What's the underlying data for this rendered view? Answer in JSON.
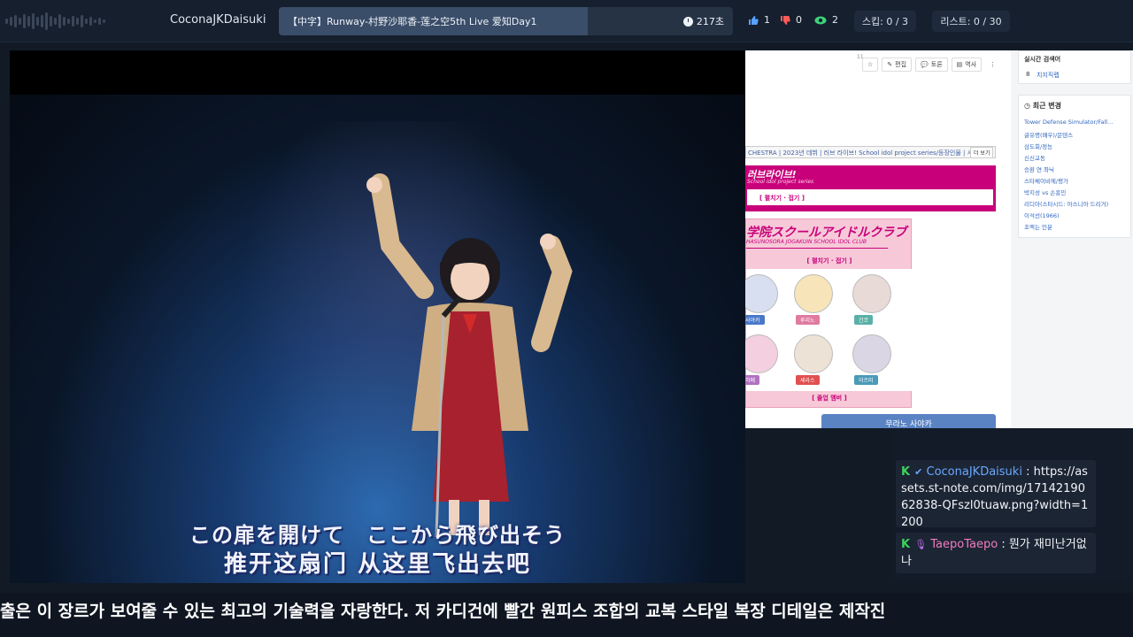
{
  "topbar": {
    "streamer": "CoconaJKDaisuki",
    "now_playing_title": "【中字】Runway-村野沙耶香-莲之空5th Live 爱知Day1",
    "now_playing_time": "217초",
    "now_playing_progress": 0.68,
    "likes": "1",
    "dislikes": "0",
    "views": "2",
    "skip": "스킵: 0 / 3",
    "list": "리스트: 0 / 30"
  },
  "video": {
    "subtitle_jp": "この扉を開けて　ここから飛び出そう",
    "subtitle_cn": "推开这扇门 从这里飞出去吧"
  },
  "wiki": {
    "tools": [
      "편집",
      "토론",
      "역사"
    ],
    "breadcrumb": "CHESTRA | 2023년 데뷔 | 러브 라이브! School idol project series/등장인물 | 시",
    "breadcrumb_more": "더 보기",
    "banner_logo": "러브라이브!",
    "banner_sub": "School idol project series",
    "banner_fold": "[ 펼치기 · 접기 ]",
    "club_logo": "学院スクールアイドルクラブ",
    "club_sub": "HASUNOSORA JOGAKUIN SCHOOL IDOL CLUB",
    "club_fold": "[ 펼치기 · 접기 ]",
    "members": [
      {
        "name": "사야카",
        "color": "#4a78c8"
      },
      {
        "name": "루리노",
        "color": "#e07aa0"
      },
      {
        "name": "긴코",
        "color": "#5ab0a8"
      },
      {
        "name": "히메",
        "color": "#b070c0"
      },
      {
        "name": "세라스",
        "color": "#e05050"
      },
      {
        "name": "이즈미",
        "color": "#4a9ab8"
      }
    ],
    "club_bottom": "[ 졸업 멤버 ]",
    "button": "무라노 사야카",
    "side_realtime_title": "실시간 검색어",
    "side_realtime_item": "치지직렙",
    "side_realtime_rank": "8",
    "page_number": "11",
    "side_recent_title": "최근 변경",
    "recent": [
      "Tower Defense Simulator/Fall...",
      "글유명(배우)/문텐스",
      "삼도회/정능",
      "신신교동",
      "승환 연 좌닉",
      "스타체이비에/평가",
      "박지성 vs 손흥민",
      "리디아(스타시드: 아스니아 드리거)",
      "이석선(1966)",
      "초맥는 인분"
    ]
  },
  "chat": [
    {
      "user": "CoconaJKDaisuki",
      "text": "https://assets.st-note.com/img/1714219062838-QFszl0tuaw.png?width=1200",
      "color": "#6aa8ff"
    },
    {
      "user": "TaepoTaepo",
      "text": "뭔가 재미난거없나",
      "color": "#f07cc0"
    }
  ],
  "caption": "출은 이 장르가 보여줄 수 있는 최고의 기술력을 자랑한다. 저 카디건에 빨간 원피스 조합의 교복 스타일 복장 디테일은 제작진"
}
